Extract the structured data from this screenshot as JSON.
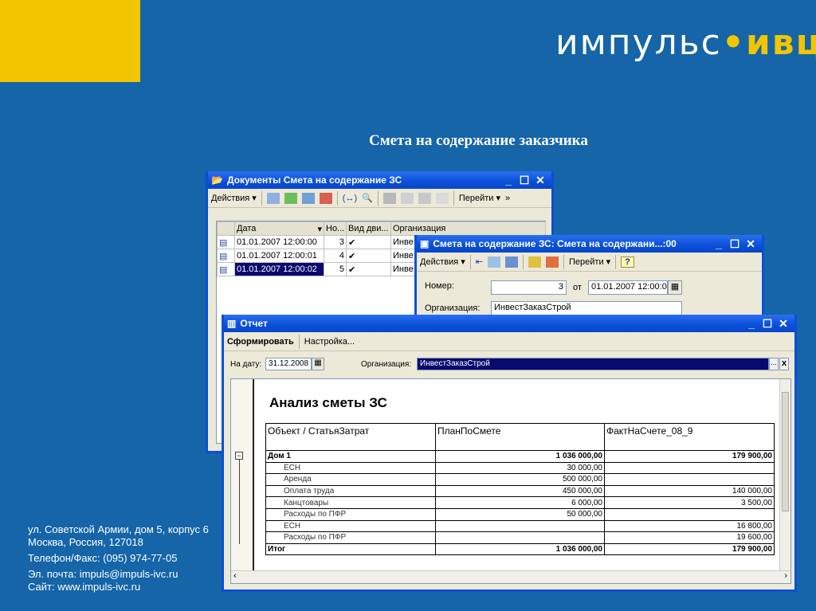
{
  "logo": {
    "part1": "импульс",
    "dot": "•",
    "part2": "ивц"
  },
  "slide_title": "Смета на содержание заказчика",
  "colors": {
    "background": "#1565a8",
    "accent": "#f2c500",
    "titlebar": "#0a4fd8",
    "selection": "#0a0a6e"
  },
  "docs_window": {
    "title": "Документы Смета на содержание ЗС",
    "actions": "Действия",
    "goto": "Перейти",
    "more": "»",
    "columns": [
      "Дата",
      "Но...",
      "Вид дви...",
      "Организация"
    ],
    "rows": [
      {
        "date": "01.01.2007 12:00:00",
        "num": "3",
        "check": "✔",
        "org": "Инве"
      },
      {
        "date": "01.01.2007 12:00:01",
        "num": "4",
        "check": "✔",
        "org": "Инве"
      },
      {
        "date": "01.01.2007 12:00:02",
        "num": "5",
        "check": "✔",
        "org": "Инве",
        "selected": true
      }
    ]
  },
  "doc_window": {
    "title": "Смета на содержание ЗС: Смета на содержани...:00",
    "actions": "Действия",
    "goto": "Перейти",
    "help": "?",
    "number_label": "Номер:",
    "number_value": "3",
    "from_label": "от",
    "date_value": "01.01.2007 12:00:0",
    "org_label": "Организация:",
    "org_value": "ИнвестЗаказСтрой"
  },
  "report_window": {
    "title": "Отчет",
    "generate": "Сформировать",
    "settings": "Настройка...",
    "date_label": "На дату:",
    "date_value": "31.12.2008",
    "org_label": "Организация:",
    "org_value": "ИнвестЗаказСтрой",
    "ellipsis": "...",
    "clear": "x",
    "report_title": "Анализ сметы ЗС",
    "headers": [
      "Объект / СтатьяЗатрат",
      "ПланПоСмете",
      "ФактНаСчете_08_9"
    ],
    "rows": [
      {
        "name": "Дом 1",
        "plan": "1 036 000,00",
        "fact": "179 900,00",
        "level": 0
      },
      {
        "name": "ЕСН",
        "plan": "30 000,00",
        "fact": "",
        "level": 1
      },
      {
        "name": "Аренда",
        "plan": "500 000,00",
        "fact": "",
        "level": 1
      },
      {
        "name": "Оплата труда",
        "plan": "450 000,00",
        "fact": "140 000,00",
        "level": 1
      },
      {
        "name": "Канцтовары",
        "plan": "6 000,00",
        "fact": "3 500,00",
        "level": 1
      },
      {
        "name": "Расходы по ПФР",
        "plan": "50 000,00",
        "fact": "",
        "level": 1
      },
      {
        "name": "ЕСН",
        "plan": "",
        "fact": "16 800,00",
        "level": 1
      },
      {
        "name": "Расходы по ПФР",
        "plan": "",
        "fact": "19 600,00",
        "level": 1
      },
      {
        "name": "Итог",
        "plan": "1 036 000,00",
        "fact": "179 900,00",
        "level": 0
      }
    ]
  },
  "contacts": {
    "address1": "ул. Советской Армии, дом 5, корпус 6",
    "address2": "Москва, Россия, 127018",
    "phone": "Телефон/Факс: (095) 974-77-05",
    "email": "Эл. почта: impuls@impuls-ivc.ru",
    "site": "Сайт: www.impuls-ivc.ru"
  }
}
